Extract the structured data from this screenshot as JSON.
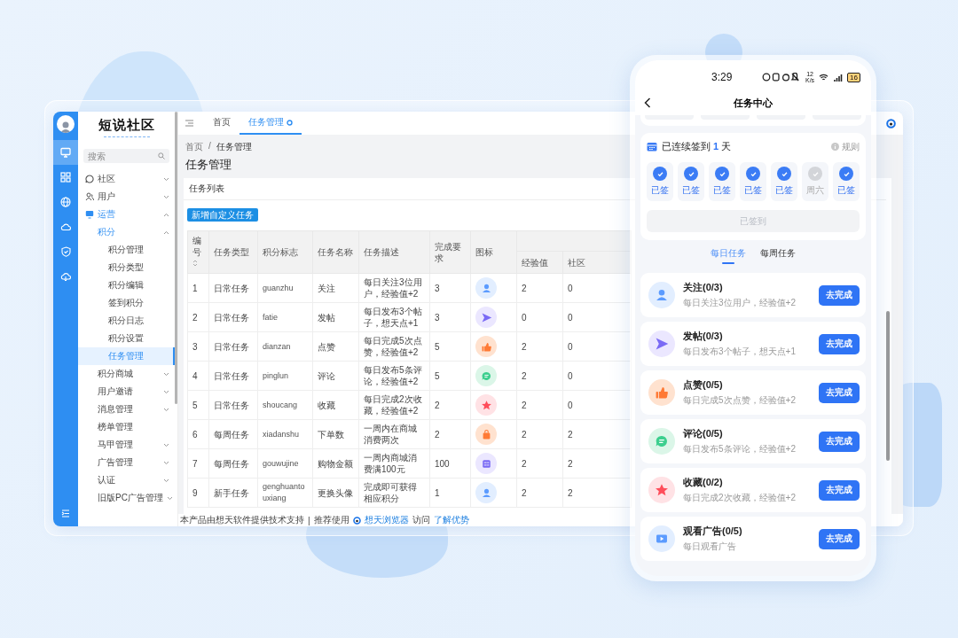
{
  "rail_items": [
    {
      "selected": true
    },
    {
      "selected": false
    },
    {
      "selected": false
    },
    {
      "selected": false
    },
    {
      "selected": false
    },
    {
      "selected": false
    }
  ],
  "sidebar": {
    "logo": "短说社区",
    "search": {
      "placeholder": "搜索"
    },
    "menu": [
      {
        "label": "社区",
        "expanded": false,
        "selected": false
      },
      {
        "label": "用户",
        "expanded": false,
        "selected": false
      },
      {
        "label": "运营",
        "expanded": true,
        "selected": false,
        "children": [
          {
            "label": "积分",
            "expanded": true,
            "selected": false,
            "children": [
              {
                "label": "积分管理",
                "selected": false
              },
              {
                "label": "积分类型",
                "selected": false
              },
              {
                "label": "积分编辑",
                "selected": false
              },
              {
                "label": "签到积分",
                "selected": false
              },
              {
                "label": "积分日志",
                "selected": false
              },
              {
                "label": "积分设置",
                "selected": false
              },
              {
                "label": "任务管理",
                "selected": true
              }
            ]
          },
          {
            "label": "积分商城",
            "expanded": false,
            "selected": false
          },
          {
            "label": "用户邀请",
            "expanded": false,
            "selected": false
          },
          {
            "label": "消息管理",
            "expanded": false,
            "selected": false
          },
          {
            "label": "榜单管理",
            "selected": false
          },
          {
            "label": "马甲管理",
            "expanded": false,
            "selected": false
          },
          {
            "label": "广告管理",
            "expanded": false,
            "selected": false
          },
          {
            "label": "认证",
            "expanded": false,
            "selected": false
          },
          {
            "label": "旧版PC广告管理",
            "expanded": false,
            "selected": false
          }
        ]
      }
    ]
  },
  "tabs": [
    {
      "label": "首页",
      "selected": false
    },
    {
      "label": "任务管理",
      "selected": true
    }
  ],
  "breadcrumb": {
    "items": [
      "首页",
      "任务管理"
    ],
    "separator": "/"
  },
  "page_title": "任务管理",
  "card": {
    "title": "任务列表",
    "add_button": "新增自定义任务",
    "table": {
      "columns": [
        "编号",
        "任务类型",
        "积分标志",
        "任务名称",
        "任务描述",
        "完成要求",
        "图标"
      ],
      "reward_columns": [
        "经验值",
        "社区"
      ],
      "rows": [
        {
          "cells": [
            "1",
            "日常任务",
            "guanzhu",
            "关注",
            "每日关注3位用户，经验值+2",
            "3"
          ],
          "rewards": [
            "2",
            "0"
          ]
        },
        {
          "cells": [
            "2",
            "日常任务",
            "fatie",
            "发帖",
            "每日发布3个帖子，想天点+1",
            "3"
          ],
          "rewards": [
            "0",
            "0"
          ]
        },
        {
          "cells": [
            "3",
            "日常任务",
            "dianzan",
            "点赞",
            "每日完成5次点赞，经验值+2",
            "5"
          ],
          "rewards": [
            "2",
            "0"
          ]
        },
        {
          "cells": [
            "4",
            "日常任务",
            "pinglun",
            "评论",
            "每日发布5条评论，经验值+2",
            "5"
          ],
          "rewards": [
            "2",
            "0"
          ]
        },
        {
          "cells": [
            "5",
            "日常任务",
            "shoucang",
            "收藏",
            "每日完成2次收藏，经验值+2",
            "2"
          ],
          "rewards": [
            "2",
            "0"
          ]
        },
        {
          "cells": [
            "6",
            "每周任务",
            "xiadanshu",
            "下单数",
            "一周内在商城消费两次",
            "2"
          ],
          "rewards": [
            "2",
            "2"
          ]
        },
        {
          "cells": [
            "7",
            "每周任务",
            "gouwujine",
            "购物金额",
            "一周内商城消费满100元",
            "100"
          ],
          "rewards": [
            "2",
            "2"
          ]
        },
        {
          "cells": [
            "9",
            "新手任务",
            "genghuantouxiang",
            "更换头像",
            "完成即可获得相应积分",
            "1"
          ],
          "rewards": [
            "2",
            "2"
          ]
        }
      ]
    }
  },
  "footer": {
    "text": "本产品由想天软件提供技术支持",
    "separator": "|",
    "recommend": "推荐使用",
    "browser_link": "想天浏览器",
    "visit": "访问",
    "advantage_link": "了解优势"
  },
  "phone": {
    "status": {
      "time": "3:29",
      "speed_value": "12",
      "speed_unit": "K/s",
      "battery": "16"
    },
    "title": "任务中心",
    "signin": {
      "prefix": "已连续签到",
      "count": "1",
      "suffix": "天",
      "rules": "规则",
      "days": [
        {
          "label": "已签",
          "checked": true
        },
        {
          "label": "已签",
          "checked": true
        },
        {
          "label": "已签",
          "checked": true
        },
        {
          "label": "已签",
          "checked": true
        },
        {
          "label": "已签",
          "checked": true
        },
        {
          "label": "周六",
          "checked": false
        },
        {
          "label": "已签",
          "checked": true
        }
      ],
      "button": {
        "label": "已签到",
        "disabled": true
      }
    },
    "task_tabs": [
      {
        "label": "每日任务",
        "selected": true
      },
      {
        "label": "每周任务",
        "selected": false
      }
    ],
    "tasks": [
      {
        "name": "关注(0/3)",
        "desc": "每日关注3位用户，经验值+2",
        "button": "去完成"
      },
      {
        "name": "发帖(0/3)",
        "desc": "每日发布3个帖子，想天点+1",
        "button": "去完成"
      },
      {
        "name": "点赞(0/5)",
        "desc": "每日完成5次点赞，经验值+2",
        "button": "去完成"
      },
      {
        "name": "评论(0/5)",
        "desc": "每日发布5条评论，经验值+2",
        "button": "去完成"
      },
      {
        "name": "收藏(0/2)",
        "desc": "每日完成2次收藏，经验值+2",
        "button": "去完成"
      },
      {
        "name": "观看广告(0/5)",
        "desc": "每日观看广告",
        "button": "去完成"
      }
    ]
  }
}
